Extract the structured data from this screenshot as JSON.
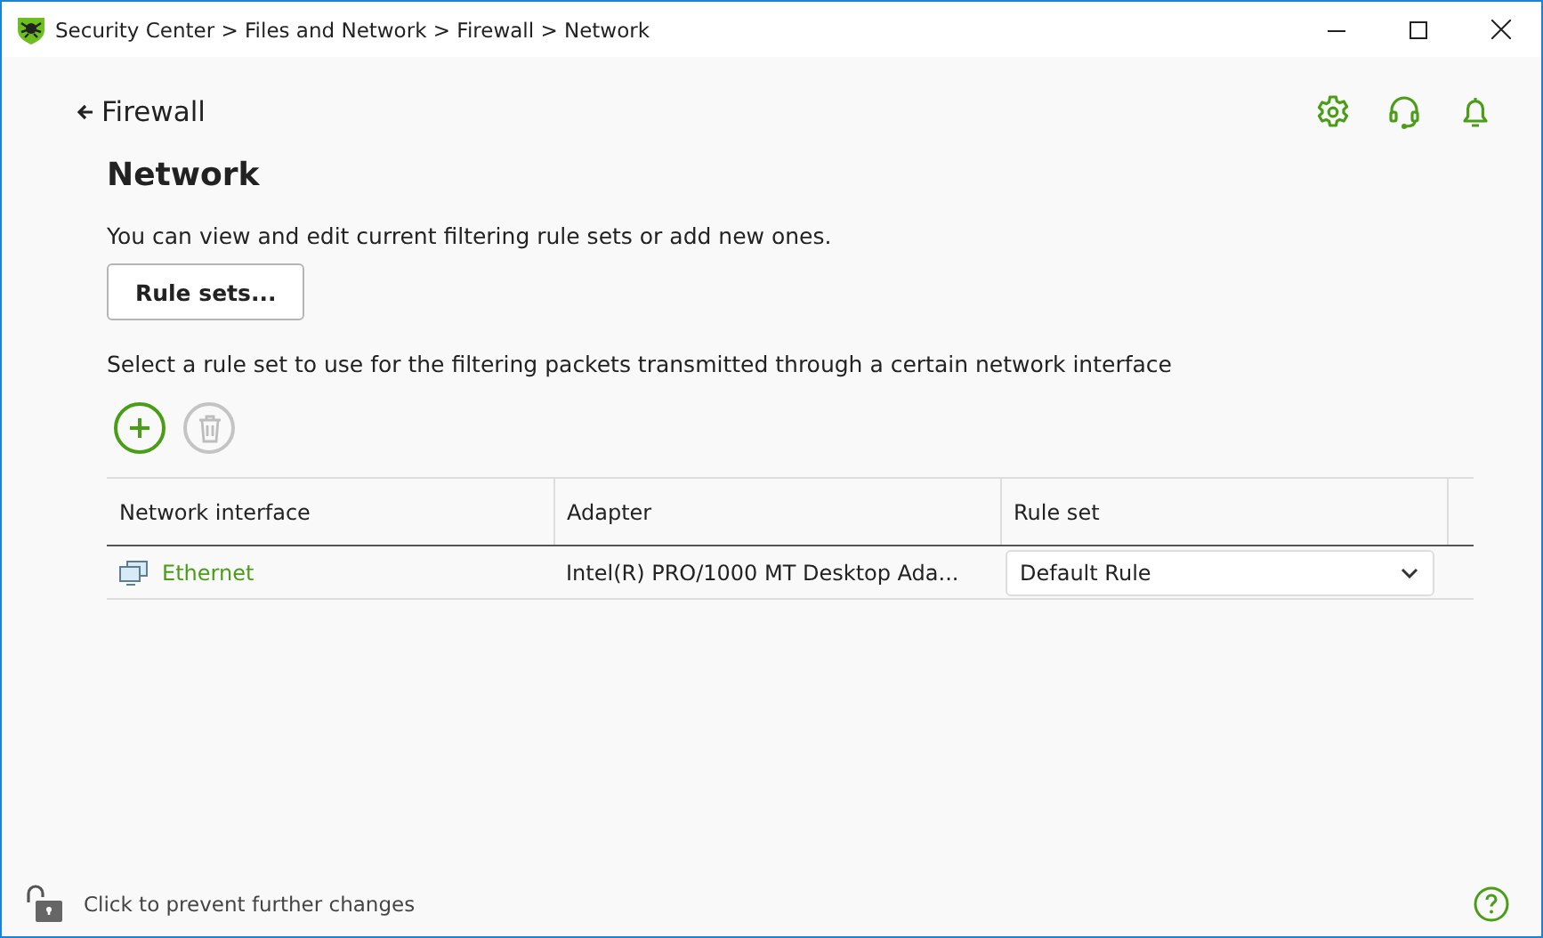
{
  "window": {
    "title": "Security Center > Files and Network > Firewall > Network"
  },
  "back_link": "Firewall",
  "heading": "Network",
  "description": "You can view and edit current filtering rule sets or add new ones.",
  "rule_sets_button": "Rule sets...",
  "instruction": "Select a rule set to use for the filtering packets transmitted through a certain network interface",
  "toolbar": [
    {
      "kind": "add",
      "disabled": false
    },
    {
      "kind": "delete",
      "disabled": true
    }
  ],
  "table": {
    "columns": [
      "Network interface",
      "Adapter",
      "Rule set"
    ],
    "rows": [
      {
        "interface": "Ethernet",
        "adapter": "Intel(R) PRO/1000 MT Desktop Ada...",
        "rule_set": "Default Rule"
      }
    ]
  },
  "status_bar": {
    "lock_text": "Click to prevent further changes"
  }
}
